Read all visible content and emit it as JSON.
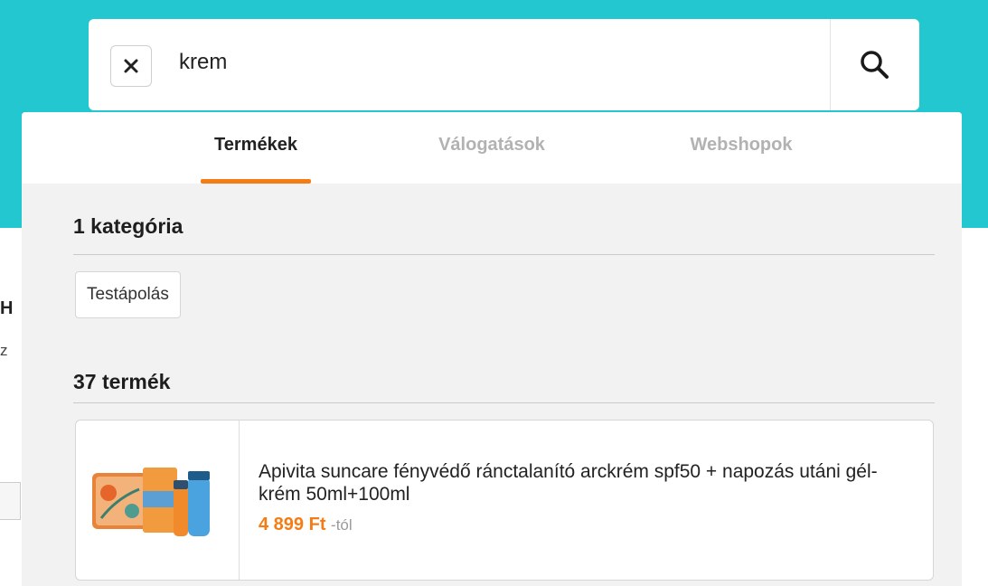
{
  "search": {
    "query": "krem",
    "clear_label": "×"
  },
  "tabs": [
    {
      "label": "Termékek",
      "active": true
    },
    {
      "label": "Válogatások",
      "active": false
    },
    {
      "label": "Webshopok",
      "active": false
    }
  ],
  "categories": {
    "heading": "1 kategória",
    "items": [
      "Testápolás"
    ]
  },
  "products": {
    "heading": "37 termék",
    "items": [
      {
        "name": "Apivita suncare fényvédő ránctalanító arckrém spf50 + napozás utáni gél-krém 50ml+100ml",
        "price": "4 899 Ft",
        "price_suffix": "-tól"
      }
    ]
  },
  "colors": {
    "brand_teal": "#22c7cf",
    "accent_orange": "#f57c14"
  },
  "icons": {
    "clear": "close-icon",
    "search": "search-icon"
  }
}
